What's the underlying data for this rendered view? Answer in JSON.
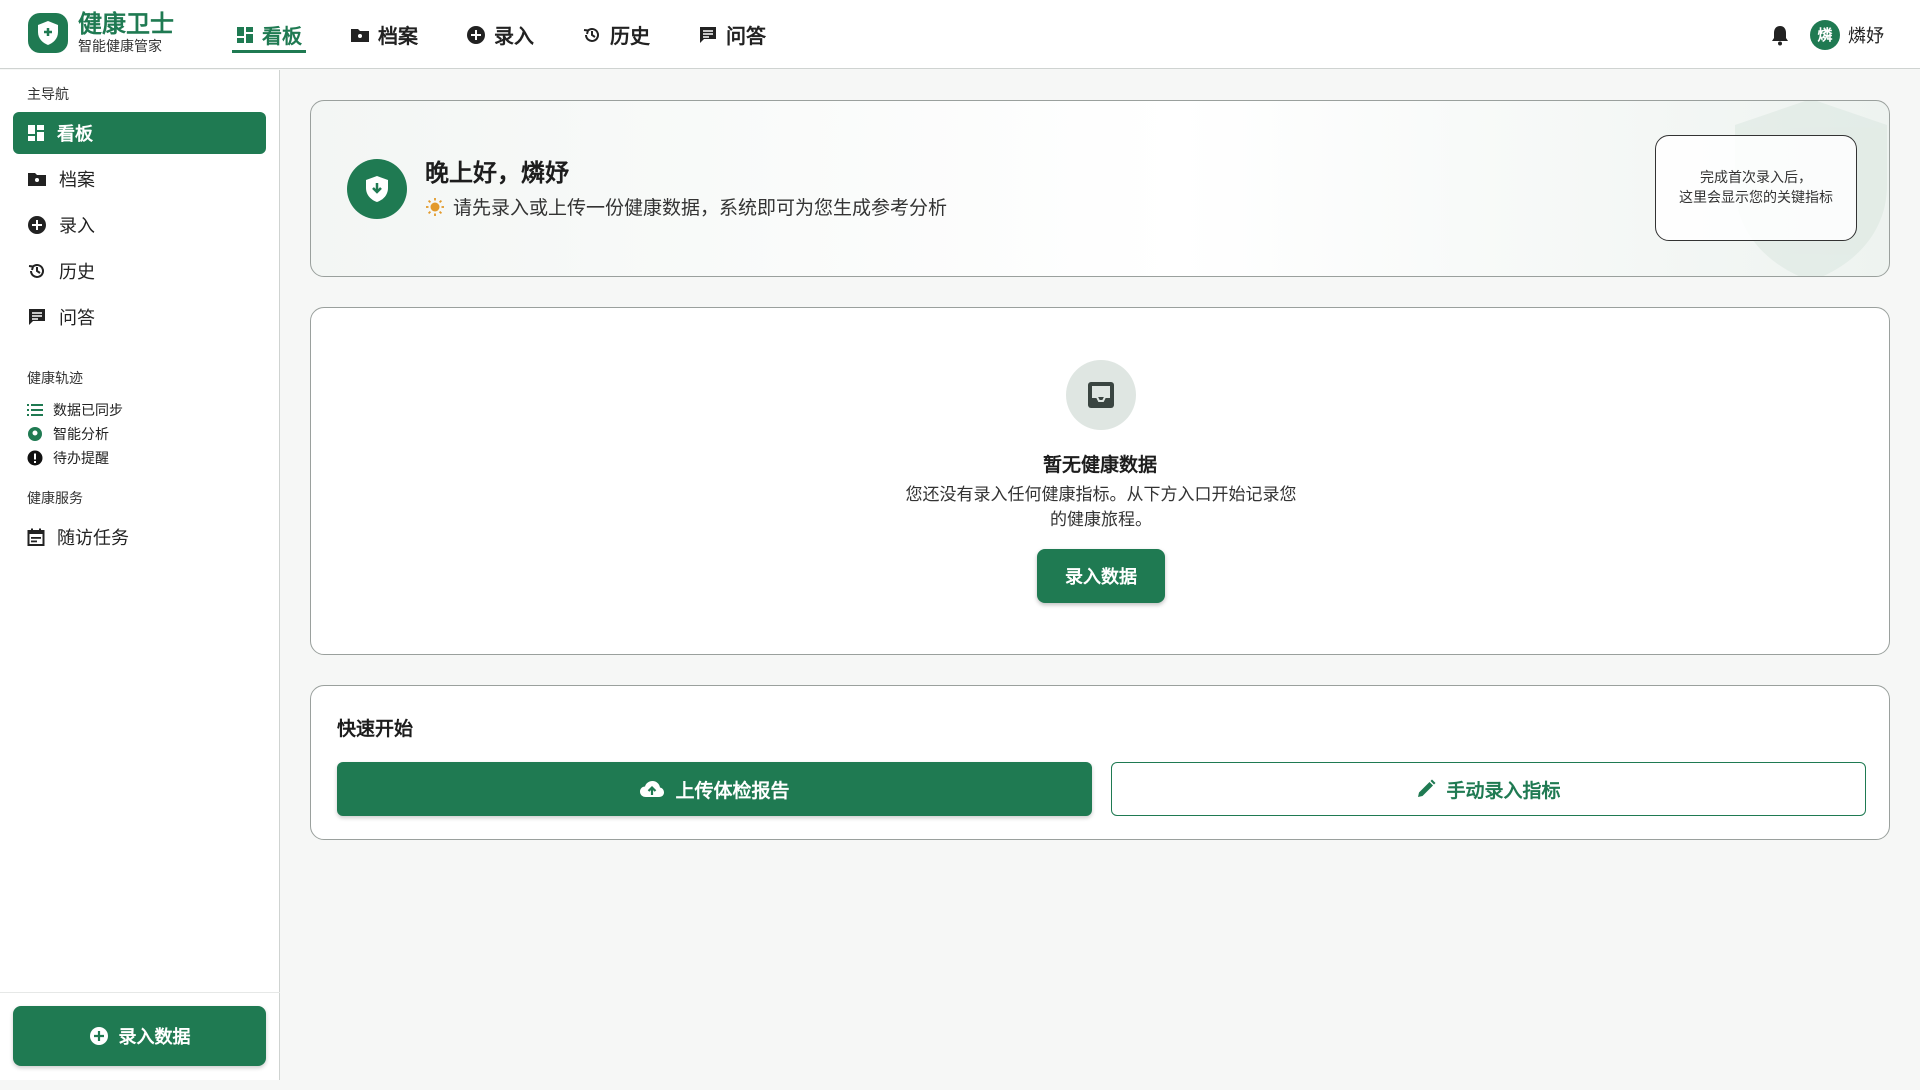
{
  "brand": {
    "title": "健康卫士",
    "subtitle": "智能健康管家"
  },
  "topnav": [
    {
      "label": "看板",
      "icon": "dashboard-icon",
      "active": true
    },
    {
      "label": "档案",
      "icon": "folder-icon"
    },
    {
      "label": "录入",
      "icon": "add-circle-icon"
    },
    {
      "label": "历史",
      "icon": "history-icon"
    },
    {
      "label": "问答",
      "icon": "chat-icon"
    }
  ],
  "user": {
    "avatar_char": "燐",
    "name": "燐妤"
  },
  "sidebar": {
    "main_label": "主导航",
    "items": [
      {
        "label": "看板",
        "icon": "dashboard-icon"
      },
      {
        "label": "档案",
        "icon": "folder-icon"
      },
      {
        "label": "录入",
        "icon": "add-circle-icon"
      },
      {
        "label": "历史",
        "icon": "history-icon"
      },
      {
        "label": "问答",
        "icon": "chat-icon"
      }
    ],
    "track_label": "健康轨迹",
    "track_items": [
      {
        "label": "数据已同步",
        "icon": "list-icon"
      },
      {
        "label": "智能分析",
        "icon": "psychology-icon"
      },
      {
        "label": "待办提醒",
        "icon": "alert-icon"
      }
    ],
    "service_label": "健康服务",
    "service_items": [
      {
        "label": "随访任务",
        "icon": "calendar-icon"
      }
    ],
    "cta_label": "录入数据"
  },
  "greeting": {
    "title": "晚上好，燐妤",
    "subtitle": "请先录入或上传一份健康数据，系统即可为您生成参考分析",
    "hint_line1": "完成首次录入后，",
    "hint_line2": "这里会显示您的关键指标"
  },
  "empty_state": {
    "title": "暂无健康数据",
    "desc": "您还没有录入任何健康指标。从下方入口开始记录您的健康旅程。",
    "button": "录入数据"
  },
  "quick_start": {
    "title": "快速开始",
    "upload_label": "上传体检报告",
    "manual_label": "手动录入指标"
  },
  "colors": {
    "primary": "#1f7a52",
    "background": "#f6f7f6"
  }
}
